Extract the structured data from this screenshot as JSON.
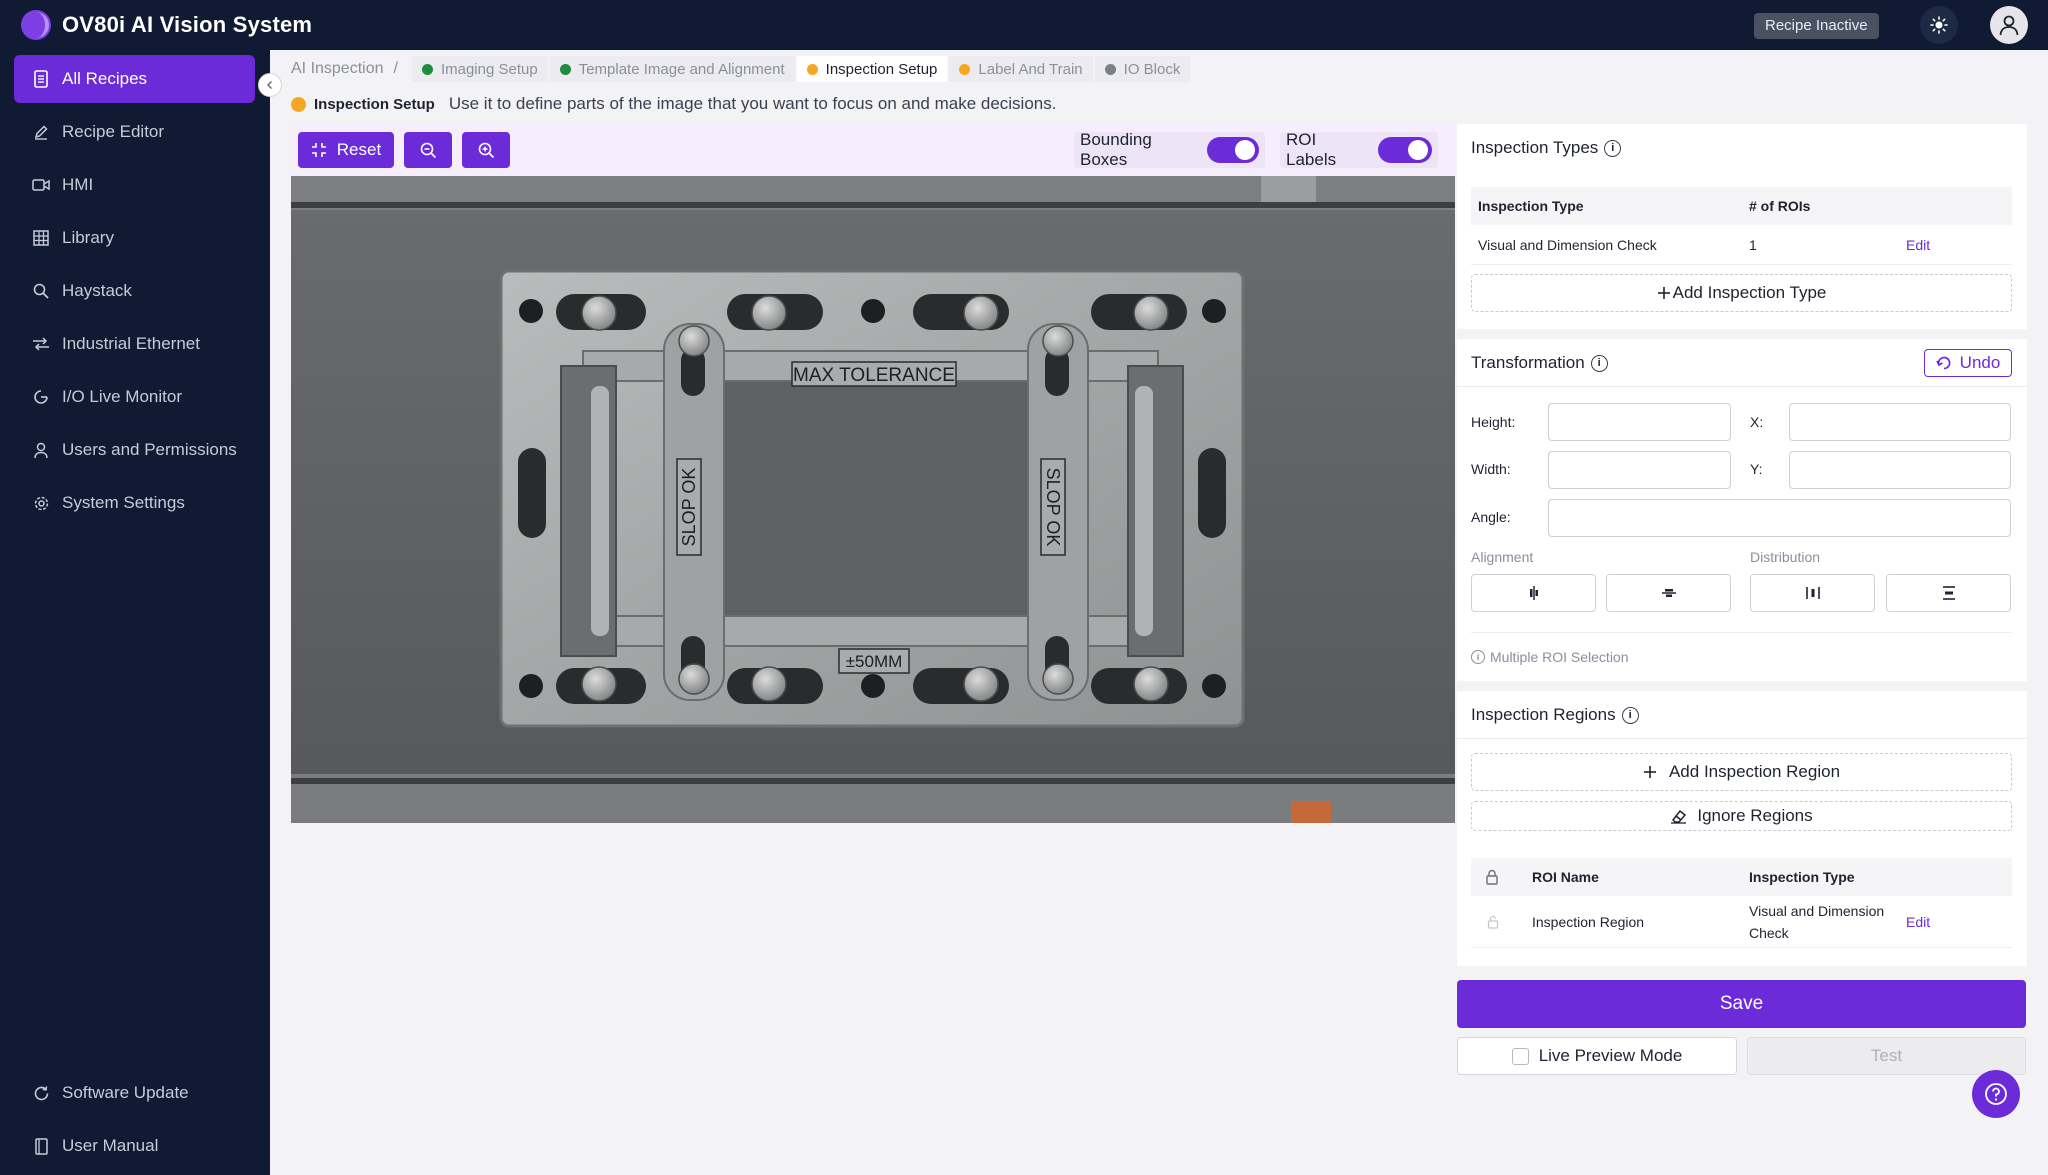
{
  "app": {
    "title": "OV80i AI Vision System",
    "recipe_status": "Recipe Inactive",
    "accent_color": "#6b2bd9"
  },
  "sidebar": {
    "items": [
      {
        "label": "All Recipes",
        "icon": "document-icon",
        "active": true
      },
      {
        "label": "Recipe Editor",
        "icon": "pencil-icon",
        "active": false
      },
      {
        "label": "HMI",
        "icon": "video-icon",
        "active": false
      },
      {
        "label": "Library",
        "icon": "grid-icon",
        "active": false
      },
      {
        "label": "Haystack",
        "icon": "search-icon",
        "active": false
      },
      {
        "label": "Industrial Ethernet",
        "icon": "network-icon",
        "active": false
      },
      {
        "label": "I/O Live Monitor",
        "icon": "monitor-icon",
        "active": false
      },
      {
        "label": "Users and Permissions",
        "icon": "user-icon",
        "active": false
      },
      {
        "label": "System Settings",
        "icon": "gear-icon",
        "active": false
      }
    ],
    "bottom": [
      {
        "label": "Software Update",
        "icon": "refresh-icon"
      },
      {
        "label": "User Manual",
        "icon": "book-icon"
      }
    ]
  },
  "breadcrumb": {
    "root": "AI Inspection",
    "separator": "/",
    "steps": [
      {
        "label": "Imaging Setup",
        "status_color": "#1e8e3e"
      },
      {
        "label": "Template Image and Alignment",
        "status_color": "#1e8e3e"
      },
      {
        "label": "Inspection Setup",
        "status_color": "#f5a623",
        "current": true
      },
      {
        "label": "Label And Train",
        "status_color": "#f5a623"
      },
      {
        "label": "IO Block",
        "status_color": "#7a7f8a"
      }
    ]
  },
  "info": {
    "step_name": "Inspection Setup",
    "description": "Use it to define parts of the image that you want to focus on and make decisions."
  },
  "toolbar": {
    "reset_label": "Reset",
    "bounding_boxes_label": "Bounding Boxes",
    "bounding_boxes_on": true,
    "roi_labels_label": "ROI Labels",
    "roi_labels_on": true
  },
  "camera_image": {
    "labels": [
      "MAX TOLERANCE",
      "SLOP OK",
      "SLOP OK",
      "±50MM"
    ]
  },
  "inspection_types": {
    "title": "Inspection Types",
    "columns": [
      "Inspection Type",
      "# of ROIs"
    ],
    "rows": [
      {
        "type": "Visual and Dimension Check",
        "rois": "1",
        "action": "Edit"
      }
    ],
    "add_label": "Add Inspection Type"
  },
  "transformation": {
    "title": "Transformation",
    "undo_label": "Undo",
    "height_label": "Height:",
    "width_label": "Width:",
    "x_label": "X:",
    "y_label": "Y:",
    "angle_label": "Angle:",
    "height_value": "",
    "width_value": "",
    "x_value": "",
    "y_value": "",
    "angle_value": "",
    "alignment_label": "Alignment",
    "distribution_label": "Distribution",
    "hint": "Multiple ROI Selection"
  },
  "inspection_regions": {
    "title": "Inspection Regions",
    "add_label": "Add Inspection Region",
    "ignore_label": "Ignore Regions",
    "columns": [
      "ROI Name",
      "Inspection Type"
    ],
    "rows": [
      {
        "name": "Inspection Region",
        "type_line1": "Visual and Dimension",
        "type_line2": "Check",
        "action": "Edit"
      }
    ]
  },
  "footer": {
    "save_label": "Save",
    "live_preview_label": "Live Preview Mode",
    "live_preview_checked": false,
    "test_label": "Test"
  }
}
